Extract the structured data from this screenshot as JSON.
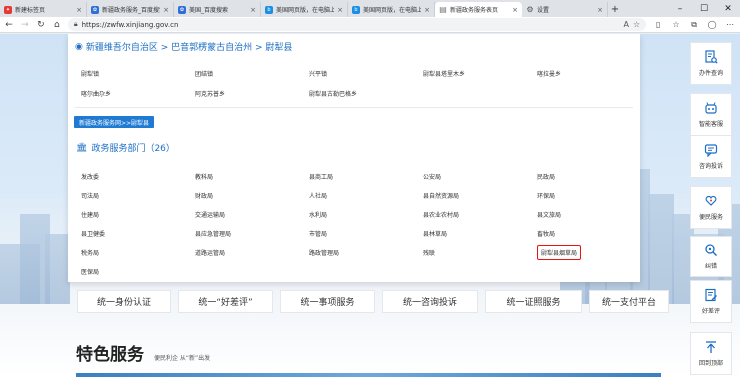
{
  "browser": {
    "tabs": [
      {
        "label": "新建标签页",
        "favicon": "edge-newtab-icon",
        "color": "#e53935",
        "active": false
      },
      {
        "label": "新疆政务服务_百度搜索",
        "favicon": "baidu-paw-icon",
        "color": "#2f6fd6",
        "active": false
      },
      {
        "label": "美国_百度搜索",
        "favicon": "baidu-paw-icon",
        "color": "#2f6fd6",
        "active": false
      },
      {
        "label": "美国网页版，在电脑上…",
        "favicon": "bing-icon",
        "color": "#1a8fe3",
        "active": false
      },
      {
        "label": "美国网页版，在电脑上…",
        "favicon": "bing-icon",
        "color": "#1a8fe3",
        "active": false
      },
      {
        "label": "新疆政务服务表页",
        "favicon": "page-icon",
        "color": "#777777",
        "active": true
      },
      {
        "label": "设置",
        "favicon": "gear-icon",
        "color": "#555555",
        "active": false
      }
    ],
    "url": "https://zwfw.xinjiang.gov.cn"
  },
  "panel": {
    "breadcrumb": "新疆维吾尔自治区 > 巴音郭楞蒙古自治州 > 尉犁县",
    "towns": [
      "尉犁镇",
      "团结镇",
      "兴平镇",
      "尉犁县塔里木乡",
      "喀拉曼乡",
      "喀尔曲尕乡",
      "阿克苏普乡",
      "尉犁县古勒巴格乡"
    ],
    "portal_button": "新疆政务服务网>>尉犁县",
    "dept_title": "政务服务部门（26）",
    "departments": [
      "发改委",
      "教科局",
      "县商工局",
      "公安局",
      "民政局",
      "司法局",
      "财政局",
      "人社局",
      "县自然资源局",
      "环保局",
      "住建局",
      "交通运输局",
      "水利局",
      "县农业农村局",
      "县文旅局",
      "县卫健委",
      "县应急管理局",
      "市管局",
      "县林草局",
      "畜牧局",
      "税务局",
      "道路运管局",
      "路政管理局",
      "残联",
      "尉犁县烟草局",
      "医保局"
    ],
    "highlighted_department": "尉犁县烟草局"
  },
  "services": [
    "统一身份认证",
    "统一“好差评”",
    "统一事项服务",
    "统一咨询投诉",
    "统一证照服务",
    "统一支付平台"
  ],
  "featured": {
    "title": "特色服务",
    "subtitle": "便民利企 从“新”出发"
  },
  "sidebar": [
    {
      "label": "办件查询",
      "icon": "document-search-icon"
    },
    {
      "label": "智能客服",
      "icon": "robot-icon"
    },
    {
      "label": "咨询投诉",
      "icon": "chat-bubble-icon"
    },
    {
      "label": "便民服务",
      "icon": "heart-hand-icon"
    },
    {
      "label": "纠错",
      "icon": "magnifier-icon"
    },
    {
      "label": "好差评",
      "icon": "rating-icon"
    },
    {
      "label": "回到顶部",
      "icon": "arrow-up-icon"
    }
  ],
  "colors": {
    "accent": "#1e6fc4",
    "highlight": "#e11111",
    "portal_button": "#1f7ad4"
  }
}
